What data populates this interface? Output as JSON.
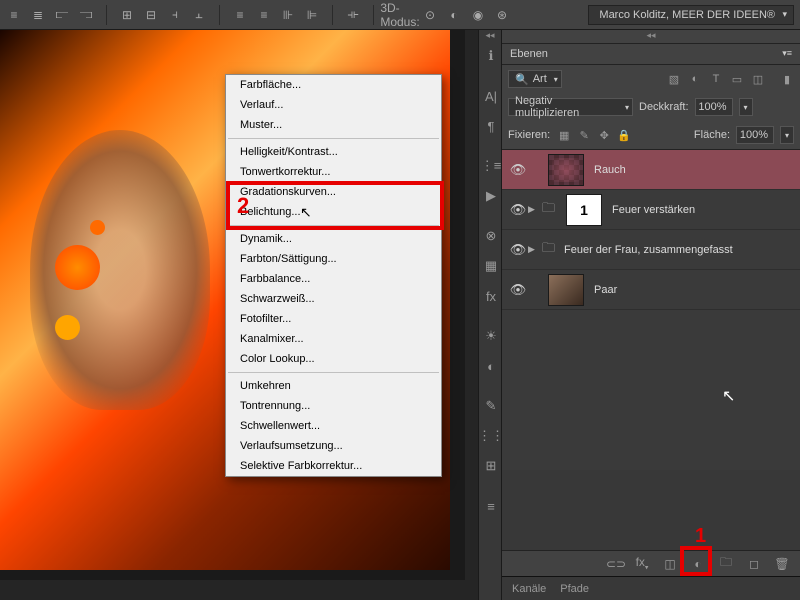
{
  "topbar": {
    "mode3d": "3D-Modus:",
    "workspace": "Marco Kolditz, MEER DER IDEEN®"
  },
  "menu": {
    "items": [
      "Farbfläche...",
      "Verlauf...",
      "Muster...",
      "-",
      "Helligkeit/Kontrast...",
      "Tonwertkorrektur...",
      "Gradationskurven...",
      "Belichtung...",
      "-",
      "Dynamik...",
      "Farbton/Sättigung...",
      "Farbbalance...",
      "Schwarzweiß...",
      "Fotofilter...",
      "Kanalmixer...",
      "Color Lookup...",
      "-",
      "Umkehren",
      "Tontrennung...",
      "Schwellenwert...",
      "Verlaufsumsetzung...",
      "Selektive Farbkorrektur..."
    ],
    "highlight": "Tonwertkorrektur..."
  },
  "panel": {
    "title": "Ebenen",
    "filter_label": "Art",
    "blend_mode": "Negativ multiplizieren",
    "opacity_label": "Deckkraft:",
    "opacity_val": "100%",
    "fill_label": "Fläche:",
    "fill_val": "100%",
    "lock_label": "Fixieren:"
  },
  "layers": [
    {
      "name": "Rauch",
      "selected": true,
      "thumb": "rauch"
    },
    {
      "name": "Feuer verstärken",
      "group": true,
      "mask": true
    },
    {
      "name": "Feuer der Frau, zusammengefasst",
      "group": true
    },
    {
      "name": "Paar",
      "thumb": "paar"
    }
  ],
  "tabs": {
    "kanale": "Kanäle",
    "pfade": "Pfade"
  },
  "annotations": {
    "one": "1",
    "two": "2"
  }
}
